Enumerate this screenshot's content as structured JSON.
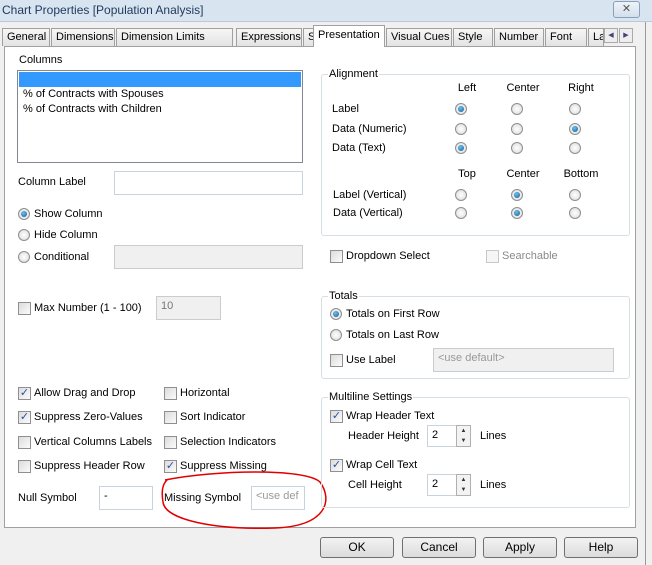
{
  "window": {
    "title": "Chart Properties [Population Analysis]",
    "close_icon": "close-icon"
  },
  "tabs": [
    {
      "label": "General"
    },
    {
      "label": "Dimensions"
    },
    {
      "label": "Dimension Limits"
    },
    {
      "label": "Expressions"
    },
    {
      "label": "Sort"
    },
    {
      "label": "Presentation",
      "active": true
    },
    {
      "label": "Visual Cues"
    },
    {
      "label": "Style"
    },
    {
      "label": "Number"
    },
    {
      "label": "Font"
    },
    {
      "label": "La"
    }
  ],
  "columns": {
    "group_label": "Columns",
    "items": [
      "",
      "% of Contracts with Spouses",
      "% of Contracts with Children"
    ],
    "selected_index": 0,
    "column_label": "Column Label",
    "column_label_value": "",
    "show_column": "Show Column",
    "hide_column": "Hide Column",
    "conditional": "Conditional",
    "selected_mode": "Show Column",
    "conditional_value": ""
  },
  "alignment": {
    "group_label": "Alignment",
    "h_headers": [
      "Left",
      "Center",
      "Right"
    ],
    "v_headers": [
      "Top",
      "Center",
      "Bottom"
    ],
    "rows": [
      {
        "label": "Label",
        "selected": "Left"
      },
      {
        "label": "Data (Numeric)",
        "selected": "Right"
      },
      {
        "label": "Data (Text)",
        "selected": "Left"
      }
    ],
    "vrows": [
      {
        "label": "Label (Vertical)",
        "selected": "Center"
      },
      {
        "label": "Data (Vertical)",
        "selected": "Center"
      }
    ]
  },
  "dropdown_select": {
    "label": "Dropdown Select",
    "checked": false
  },
  "searchable": {
    "label": "Searchable",
    "checked": false,
    "disabled": true
  },
  "max_number": {
    "label": "Max Number (1 - 100)",
    "checked": false,
    "value": "10"
  },
  "totals": {
    "group_label": "Totals",
    "first": "Totals on First Row",
    "last": "Totals on Last Row",
    "selected": "first",
    "use_label": "Use Label",
    "use_label_checked": false,
    "label_placeholder": "<use default>"
  },
  "options": {
    "allow_drag": {
      "label": "Allow Drag and Drop",
      "checked": true
    },
    "suppress_zero": {
      "label": "Suppress Zero-Values",
      "checked": true
    },
    "vertical_labels": {
      "label": "Vertical Columns Labels",
      "checked": false
    },
    "suppress_header": {
      "label": "Suppress Header Row",
      "checked": false
    },
    "horizontal": {
      "label": "Horizontal",
      "checked": false
    },
    "sort_indicator": {
      "label": "Sort Indicator",
      "checked": false
    },
    "selection_indicators": {
      "label": "Selection Indicators",
      "checked": false
    },
    "suppress_missing": {
      "label": "Suppress Missing",
      "checked": true
    }
  },
  "null_symbol": {
    "label": "Null Symbol",
    "value": "-"
  },
  "missing_symbol": {
    "label": "Missing Symbol",
    "value": "<use def"
  },
  "multiline": {
    "group_label": "Multiline Settings",
    "wrap_header": "Wrap Header Text",
    "wrap_header_checked": true,
    "header_height": "Header Height",
    "header_value": "2",
    "lines": "Lines",
    "wrap_cell": "Wrap Cell Text",
    "wrap_cell_checked": true,
    "cell_height": "Cell Height",
    "cell_value": "2"
  },
  "buttons": {
    "ok": "OK",
    "cancel": "Cancel",
    "apply": "Apply",
    "help": "Help"
  },
  "annotation_color": "#e00000"
}
